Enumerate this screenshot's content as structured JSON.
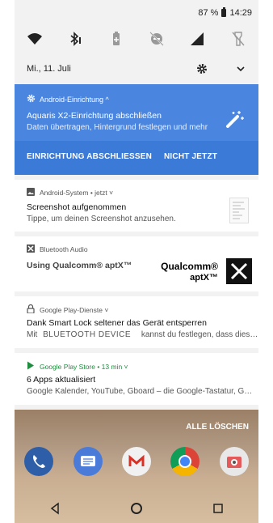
{
  "status": {
    "battery_text": "87 %",
    "time": "14:29"
  },
  "quick_settings": [
    "wifi-icon",
    "bluetooth-icon",
    "battery-saver-icon",
    "dnd-off-icon",
    "cellular-icon",
    "flashlight-off-icon"
  ],
  "date": "Mi., 11. Juli",
  "notifications": {
    "setup": {
      "app": "Android-Einrichtung ^",
      "title": "Aquaris X2-Einrichtung abschließen",
      "text": "Daten übertragen, Hintergrund festlegen und mehr",
      "action_finish": "EINRICHTUNG ABSCHLIESSEN",
      "action_later": "NICHT JETZT"
    },
    "screenshot": {
      "app": "Android-System • jetzt ˅",
      "title": "Screenshot aufgenommen",
      "text": "Tippe, um deinen Screenshot anzusehen."
    },
    "bluetooth": {
      "app": "Bluetooth Audio",
      "title": "Using Qualcomm® aptX™",
      "logo_line1": "Qualcomm®",
      "logo_line2": "aptX™"
    },
    "smartlock": {
      "app": "Google Play-Dienste ˅",
      "title": "Dank Smart Lock seltener das Gerät entsperren",
      "text_prefix": "Mit",
      "device": "BLUETOOTH DEVICE",
      "text_suffix": "kannst du festlegen, dass dies…"
    },
    "playstore": {
      "app": "Google Play Store • 13 min ˅",
      "title": "6 Apps aktualisiert",
      "text": "Google Kalender, YouTube, Gboard – die Google-Tastatur, G…"
    }
  },
  "clear_all": "ALLE LÖSCHEN",
  "dock_apps": [
    "phone-icon",
    "messages-icon",
    "gmail-icon",
    "chrome-icon",
    "camera-icon"
  ],
  "colors": {
    "blue_card": "#4a86e0",
    "blue_actions": "#3b7ad7",
    "play_green": "#1e8e3e"
  }
}
